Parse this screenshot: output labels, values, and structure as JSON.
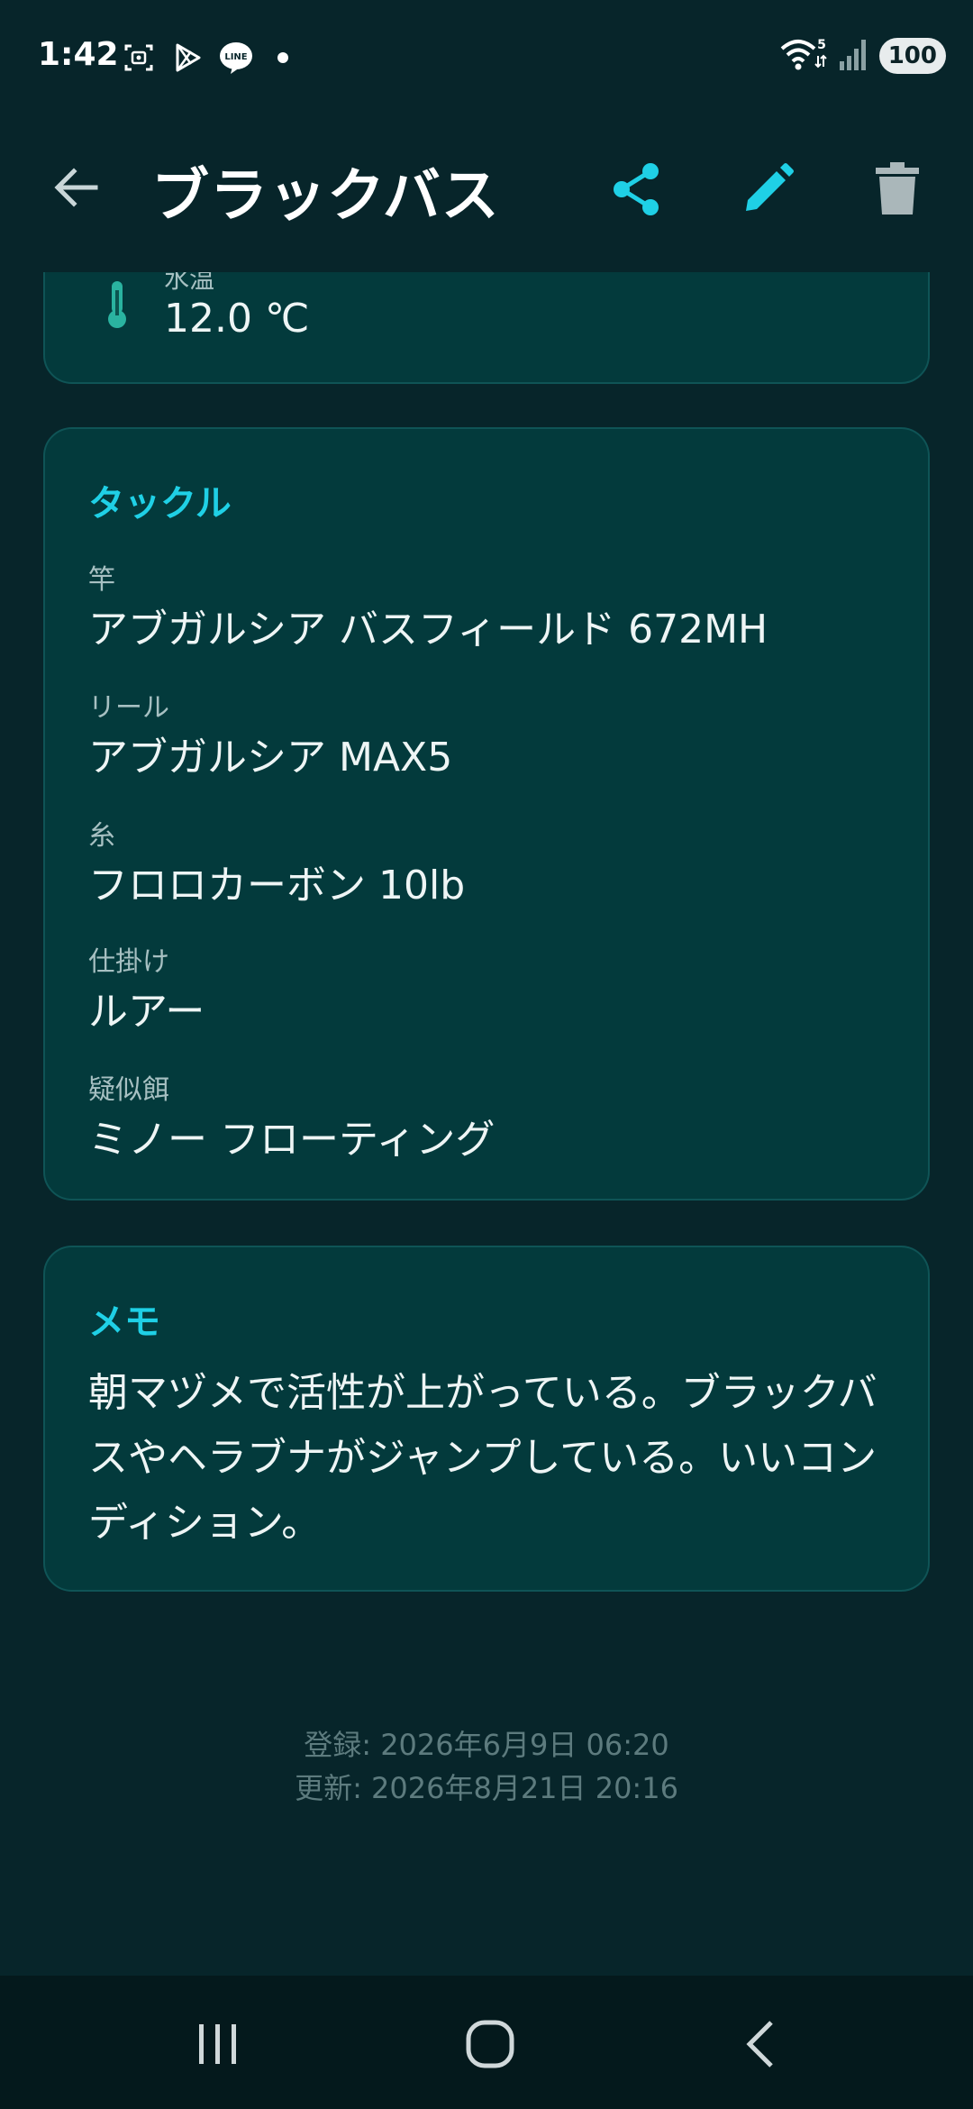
{
  "status_bar": {
    "time": "1:42",
    "battery": "100",
    "wifi_badge": "5"
  },
  "app_bar": {
    "title": "ブラックバス"
  },
  "colors": {
    "accent": "#1fd0e6",
    "background": "#07252a",
    "card": "#033a3c",
    "thermo": "#2ab3a0"
  },
  "icons": [
    "back-arrow-icon",
    "share-icon",
    "pencil-icon",
    "trash-icon",
    "thermometer-icon"
  ],
  "weather_card": {
    "label_partial": "水温",
    "water_temp": "12.0 ℃"
  },
  "tackle": {
    "heading": "タックル",
    "fields": [
      {
        "label": "竿",
        "value": "アブガルシア バスフィールド 672MH"
      },
      {
        "label": "リール",
        "value": "アブガルシア MAX5"
      },
      {
        "label": "糸",
        "value": "フロロカーボン 10lb"
      },
      {
        "label": "仕掛け",
        "value": "ルアー"
      },
      {
        "label": "疑似餌",
        "value": "ミノー フローティング"
      }
    ]
  },
  "memo": {
    "heading": "メモ",
    "text": "朝マヅメで活性が上がっている。ブラックバスやヘラブナがジャンプしている。いいコンディション。"
  },
  "timestamps": {
    "created": "登録: 2026年6月9日 06:20",
    "updated": "更新: 2026年8月21日 20:16"
  }
}
